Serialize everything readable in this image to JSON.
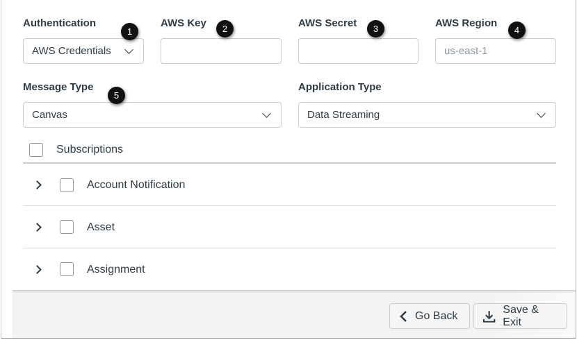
{
  "fields": {
    "authentication": {
      "label": "Authentication",
      "value": "AWS Credentials"
    },
    "aws_key": {
      "label": "AWS Key",
      "value": ""
    },
    "aws_secret": {
      "label": "AWS Secret",
      "value": ""
    },
    "aws_region": {
      "label": "AWS Region",
      "placeholder": "us-east-1"
    },
    "message_type": {
      "label": "Message Type",
      "value": "Canvas"
    },
    "application_type": {
      "label": "Application Type",
      "value": "Data Streaming"
    }
  },
  "badges": [
    "1",
    "2",
    "3",
    "4",
    "5"
  ],
  "subscriptions": {
    "label": "Subscriptions",
    "items": [
      "Account Notification",
      "Asset",
      "Assignment"
    ]
  },
  "buttons": {
    "go_back": "Go Back",
    "save_exit": "Save & Exit"
  }
}
